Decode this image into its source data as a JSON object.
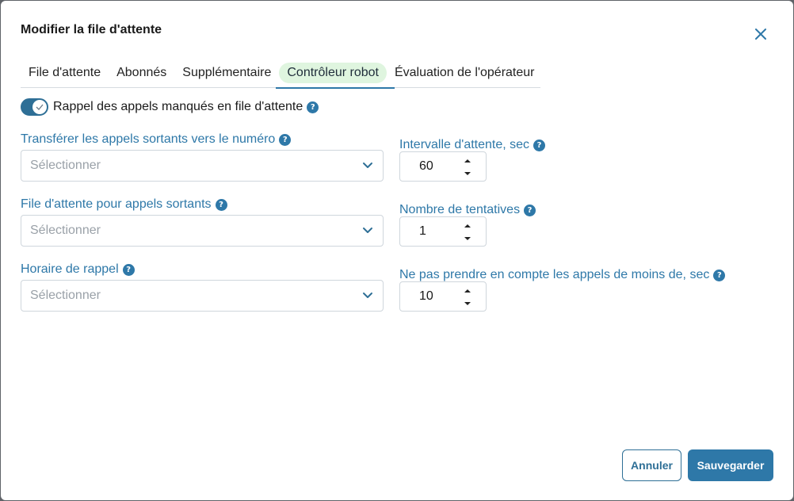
{
  "dialog": {
    "title": "Modifier la file d'attente"
  },
  "tabs": [
    {
      "label": "File d'attente",
      "active": false
    },
    {
      "label": "Abonnés",
      "active": false
    },
    {
      "label": "Supplémentaire",
      "active": false
    },
    {
      "label": "Contrôleur robot",
      "active": true
    },
    {
      "label": "Évaluation de l'opérateur",
      "active": false
    }
  ],
  "toggle": {
    "label": "Rappel des appels manqués en file d'attente",
    "on": true
  },
  "left_fields": [
    {
      "label": "Transférer les appels sortants vers le numéro",
      "placeholder": "Sélectionner"
    },
    {
      "label": "File d'attente pour appels sortants",
      "placeholder": "Sélectionner"
    },
    {
      "label": "Horaire de rappel",
      "placeholder": "Sélectionner"
    }
  ],
  "right_fields": [
    {
      "label": "Intervalle d'attente, sec",
      "value": "60"
    },
    {
      "label": "Nombre de tentatives",
      "value": "1"
    },
    {
      "label": "Ne pas prendre en compte les appels de moins de, sec",
      "value": "10"
    }
  ],
  "help_glyph": "?",
  "buttons": {
    "cancel": "Annuler",
    "save": "Sauvegarder"
  },
  "colors": {
    "accent": "#2e78a8",
    "active_tab_bg": "#dff5df",
    "placeholder": "#9aa1a8"
  }
}
